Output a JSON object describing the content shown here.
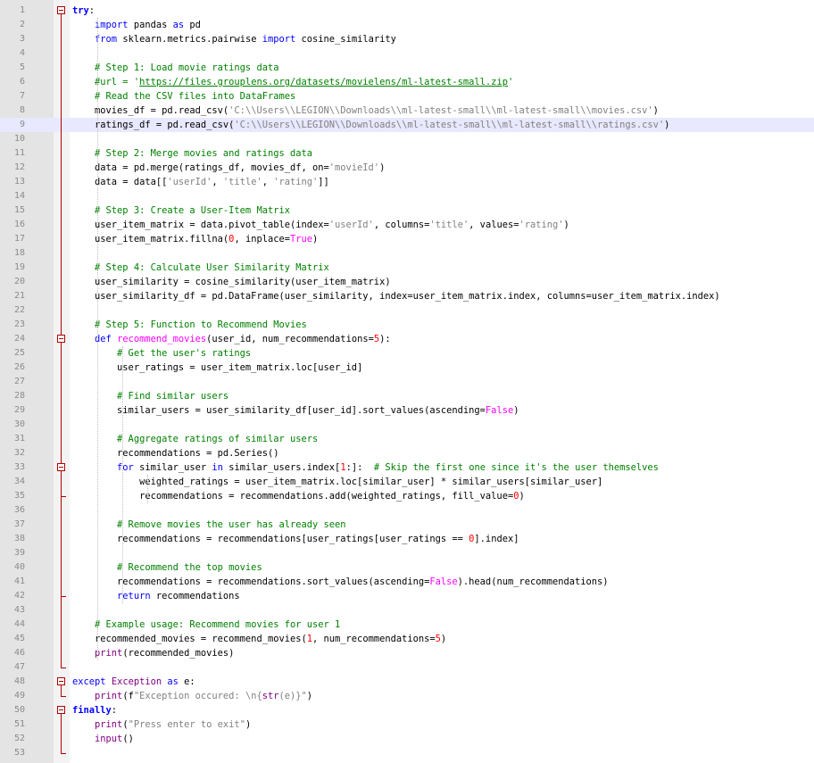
{
  "editor": {
    "lines": [
      {
        "n": "1",
        "code": [
          {
            "t": "try",
            "c": "kw"
          },
          {
            "t": ":"
          }
        ]
      },
      {
        "n": "2",
        "code": [
          {
            "t": "    "
          },
          {
            "t": "import",
            "c": "kw2"
          },
          {
            "t": " pandas "
          },
          {
            "t": "as",
            "c": "kw2"
          },
          {
            "t": " pd"
          }
        ]
      },
      {
        "n": "3",
        "code": [
          {
            "t": "    "
          },
          {
            "t": "from",
            "c": "kw2"
          },
          {
            "t": " sklearn.metrics.pairwise "
          },
          {
            "t": "import",
            "c": "kw2"
          },
          {
            "t": " cosine_similarity"
          }
        ]
      },
      {
        "n": "4",
        "code": []
      },
      {
        "n": "5",
        "code": [
          {
            "t": "    "
          },
          {
            "t": "# Step 1: Load movie ratings data",
            "c": "cm"
          }
        ]
      },
      {
        "n": "6",
        "code": [
          {
            "t": "    "
          },
          {
            "t": "#url = '",
            "c": "cm"
          },
          {
            "t": "https://files.grouplens.org/datasets/movielens/ml-latest-small.zip",
            "c": "cm ul"
          },
          {
            "t": "'",
            "c": "cm"
          }
        ]
      },
      {
        "n": "7",
        "code": [
          {
            "t": "    "
          },
          {
            "t": "# Read the CSV files into DataFrames",
            "c": "cm"
          }
        ]
      },
      {
        "n": "8",
        "code": [
          {
            "t": "    movies_df = pd.read_csv("
          },
          {
            "t": "'C:\\\\Users\\\\LEGION\\\\Downloads\\\\ml-latest-small\\\\ml-latest-small\\\\movies.csv'",
            "c": "st"
          },
          {
            "t": ")"
          }
        ]
      },
      {
        "n": "9",
        "code": [
          {
            "t": "    ratings_df = pd.read_csv("
          },
          {
            "t": "'C:\\\\Users\\\\LEGION\\\\Downloads\\\\ml-latest-small\\\\ml-latest-small\\\\ratings.csv'",
            "c": "st"
          },
          {
            "t": ")"
          }
        ],
        "current": true
      },
      {
        "n": "10",
        "code": []
      },
      {
        "n": "11",
        "code": [
          {
            "t": "    "
          },
          {
            "t": "# Step 2: Merge movies and ratings data",
            "c": "cm"
          }
        ]
      },
      {
        "n": "12",
        "code": [
          {
            "t": "    data = pd.merge(ratings_df, movies_df, on="
          },
          {
            "t": "'movieId'",
            "c": "st"
          },
          {
            "t": ")"
          }
        ]
      },
      {
        "n": "13",
        "code": [
          {
            "t": "    data = data[["
          },
          {
            "t": "'userId'",
            "c": "st"
          },
          {
            "t": ", "
          },
          {
            "t": "'title'",
            "c": "st"
          },
          {
            "t": ", "
          },
          {
            "t": "'rating'",
            "c": "st"
          },
          {
            "t": "]]"
          }
        ]
      },
      {
        "n": "14",
        "code": []
      },
      {
        "n": "15",
        "code": [
          {
            "t": "    "
          },
          {
            "t": "# Step 3: Create a User-Item Matrix",
            "c": "cm"
          }
        ]
      },
      {
        "n": "16",
        "code": [
          {
            "t": "    user_item_matrix = data.pivot_table(index="
          },
          {
            "t": "'userId'",
            "c": "st"
          },
          {
            "t": ", columns="
          },
          {
            "t": "'title'",
            "c": "st"
          },
          {
            "t": ", values="
          },
          {
            "t": "'rating'",
            "c": "st"
          },
          {
            "t": ")"
          }
        ]
      },
      {
        "n": "17",
        "code": [
          {
            "t": "    user_item_matrix.fillna("
          },
          {
            "t": "0",
            "c": "nu"
          },
          {
            "t": ", inplace="
          },
          {
            "t": "True",
            "c": "fn"
          },
          {
            "t": ")"
          }
        ]
      },
      {
        "n": "18",
        "code": []
      },
      {
        "n": "19",
        "code": [
          {
            "t": "    "
          },
          {
            "t": "# Step 4: Calculate User Similarity Matrix",
            "c": "cm"
          }
        ]
      },
      {
        "n": "20",
        "code": [
          {
            "t": "    user_similarity = cosine_similarity(user_item_matrix)"
          }
        ]
      },
      {
        "n": "21",
        "code": [
          {
            "t": "    user_similarity_df = pd.DataFrame(user_similarity, index=user_item_matrix.index, columns=user_item_matrix.index)"
          }
        ]
      },
      {
        "n": "22",
        "code": []
      },
      {
        "n": "23",
        "code": [
          {
            "t": "    "
          },
          {
            "t": "# Step 5: Function to Recommend Movies",
            "c": "cm"
          }
        ]
      },
      {
        "n": "24",
        "code": [
          {
            "t": "    "
          },
          {
            "t": "def",
            "c": "kw2"
          },
          {
            "t": " "
          },
          {
            "t": "recommend_movies",
            "c": "fn"
          },
          {
            "t": "(user_id, num_recommendations="
          },
          {
            "t": "5",
            "c": "nu"
          },
          {
            "t": "):"
          }
        ]
      },
      {
        "n": "25",
        "code": [
          {
            "t": "        "
          },
          {
            "t": "# Get the user's ratings",
            "c": "cm"
          }
        ]
      },
      {
        "n": "26",
        "code": [
          {
            "t": "        user_ratings = user_item_matrix.loc[user_id]"
          }
        ]
      },
      {
        "n": "27",
        "code": []
      },
      {
        "n": "28",
        "code": [
          {
            "t": "        "
          },
          {
            "t": "# Find similar users",
            "c": "cm"
          }
        ]
      },
      {
        "n": "29",
        "code": [
          {
            "t": "        similar_users = user_similarity_df[user_id].sort_values(ascending="
          },
          {
            "t": "False",
            "c": "fn"
          },
          {
            "t": ")"
          }
        ]
      },
      {
        "n": "30",
        "code": []
      },
      {
        "n": "31",
        "code": [
          {
            "t": "        "
          },
          {
            "t": "# Aggregate ratings of similar users",
            "c": "cm"
          }
        ]
      },
      {
        "n": "32",
        "code": [
          {
            "t": "        recommendations = pd.Series()"
          }
        ]
      },
      {
        "n": "33",
        "code": [
          {
            "t": "        "
          },
          {
            "t": "for",
            "c": "kw2"
          },
          {
            "t": " similar_user "
          },
          {
            "t": "in",
            "c": "kw2"
          },
          {
            "t": " similar_users.index["
          },
          {
            "t": "1",
            "c": "nu"
          },
          {
            "t": ":]:  "
          },
          {
            "t": "# Skip the first one since it's the user themselves",
            "c": "cm"
          }
        ]
      },
      {
        "n": "34",
        "code": [
          {
            "t": "            weighted_ratings = user_item_matrix.loc[similar_user] * similar_users[similar_user]"
          }
        ]
      },
      {
        "n": "35",
        "code": [
          {
            "t": "            recommendations = recommendations.add(weighted_ratings, fill_value="
          },
          {
            "t": "0",
            "c": "nu"
          },
          {
            "t": ")"
          }
        ]
      },
      {
        "n": "36",
        "code": []
      },
      {
        "n": "37",
        "code": [
          {
            "t": "        "
          },
          {
            "t": "# Remove movies the user has already seen",
            "c": "cm"
          }
        ]
      },
      {
        "n": "38",
        "code": [
          {
            "t": "        recommendations = recommendations[user_ratings[user_ratings == "
          },
          {
            "t": "0",
            "c": "nu"
          },
          {
            "t": "].index]"
          }
        ]
      },
      {
        "n": "39",
        "code": []
      },
      {
        "n": "40",
        "code": [
          {
            "t": "        "
          },
          {
            "t": "# Recommend the top movies",
            "c": "cm"
          }
        ]
      },
      {
        "n": "41",
        "code": [
          {
            "t": "        recommendations = recommendations.sort_values(ascending="
          },
          {
            "t": "False",
            "c": "fn"
          },
          {
            "t": ").head(num_recommendations)"
          }
        ]
      },
      {
        "n": "42",
        "code": [
          {
            "t": "        "
          },
          {
            "t": "return",
            "c": "kw2"
          },
          {
            "t": " recommendations"
          }
        ]
      },
      {
        "n": "43",
        "code": []
      },
      {
        "n": "44",
        "code": [
          {
            "t": "    "
          },
          {
            "t": "# Example usage: Recommend movies for user 1",
            "c": "cm"
          }
        ]
      },
      {
        "n": "45",
        "code": [
          {
            "t": "    recommended_movies = recommend_movies("
          },
          {
            "t": "1",
            "c": "nu"
          },
          {
            "t": ", num_recommendations="
          },
          {
            "t": "5",
            "c": "nu"
          },
          {
            "t": ")"
          }
        ]
      },
      {
        "n": "46",
        "code": [
          {
            "t": "    "
          },
          {
            "t": "print",
            "c": "bi"
          },
          {
            "t": "(recommended_movies)"
          }
        ]
      },
      {
        "n": "47",
        "code": []
      },
      {
        "n": "48",
        "code": [
          {
            "t": "except",
            "c": "kw2"
          },
          {
            "t": " "
          },
          {
            "t": "Exception",
            "c": "bi"
          },
          {
            "t": " "
          },
          {
            "t": "as",
            "c": "kw2"
          },
          {
            "t": " e:"
          }
        ]
      },
      {
        "n": "49",
        "code": [
          {
            "t": "    "
          },
          {
            "t": "print",
            "c": "bi"
          },
          {
            "t": "(f"
          },
          {
            "t": "\"Exception occured: \\n{",
            "c": "st"
          },
          {
            "t": "str",
            "c": "bi"
          },
          {
            "t": "(e)",
            "c": "st"
          },
          {
            "t": "}\"",
            "c": "st"
          },
          {
            "t": ")"
          }
        ]
      },
      {
        "n": "50",
        "code": [
          {
            "t": "finally",
            "c": "kw"
          },
          {
            "t": ":"
          }
        ]
      },
      {
        "n": "51",
        "code": [
          {
            "t": "    "
          },
          {
            "t": "print",
            "c": "bi"
          },
          {
            "t": "("
          },
          {
            "t": "\"Press enter to exit\"",
            "c": "st"
          },
          {
            "t": ")"
          }
        ]
      },
      {
        "n": "52",
        "code": [
          {
            "t": "    "
          },
          {
            "t": "input",
            "c": "bi"
          },
          {
            "t": "()"
          }
        ]
      },
      {
        "n": "53",
        "code": []
      }
    ],
    "colors": {
      "keyword": "#0000ff",
      "comment": "#008000",
      "string": "#808080",
      "number": "#ff0000",
      "constant": "#ff00ff",
      "builtin": "#800080",
      "current_line": "#e8e8ff",
      "gutter": "#e4e4e4",
      "fold_marker": "#b00000"
    }
  }
}
